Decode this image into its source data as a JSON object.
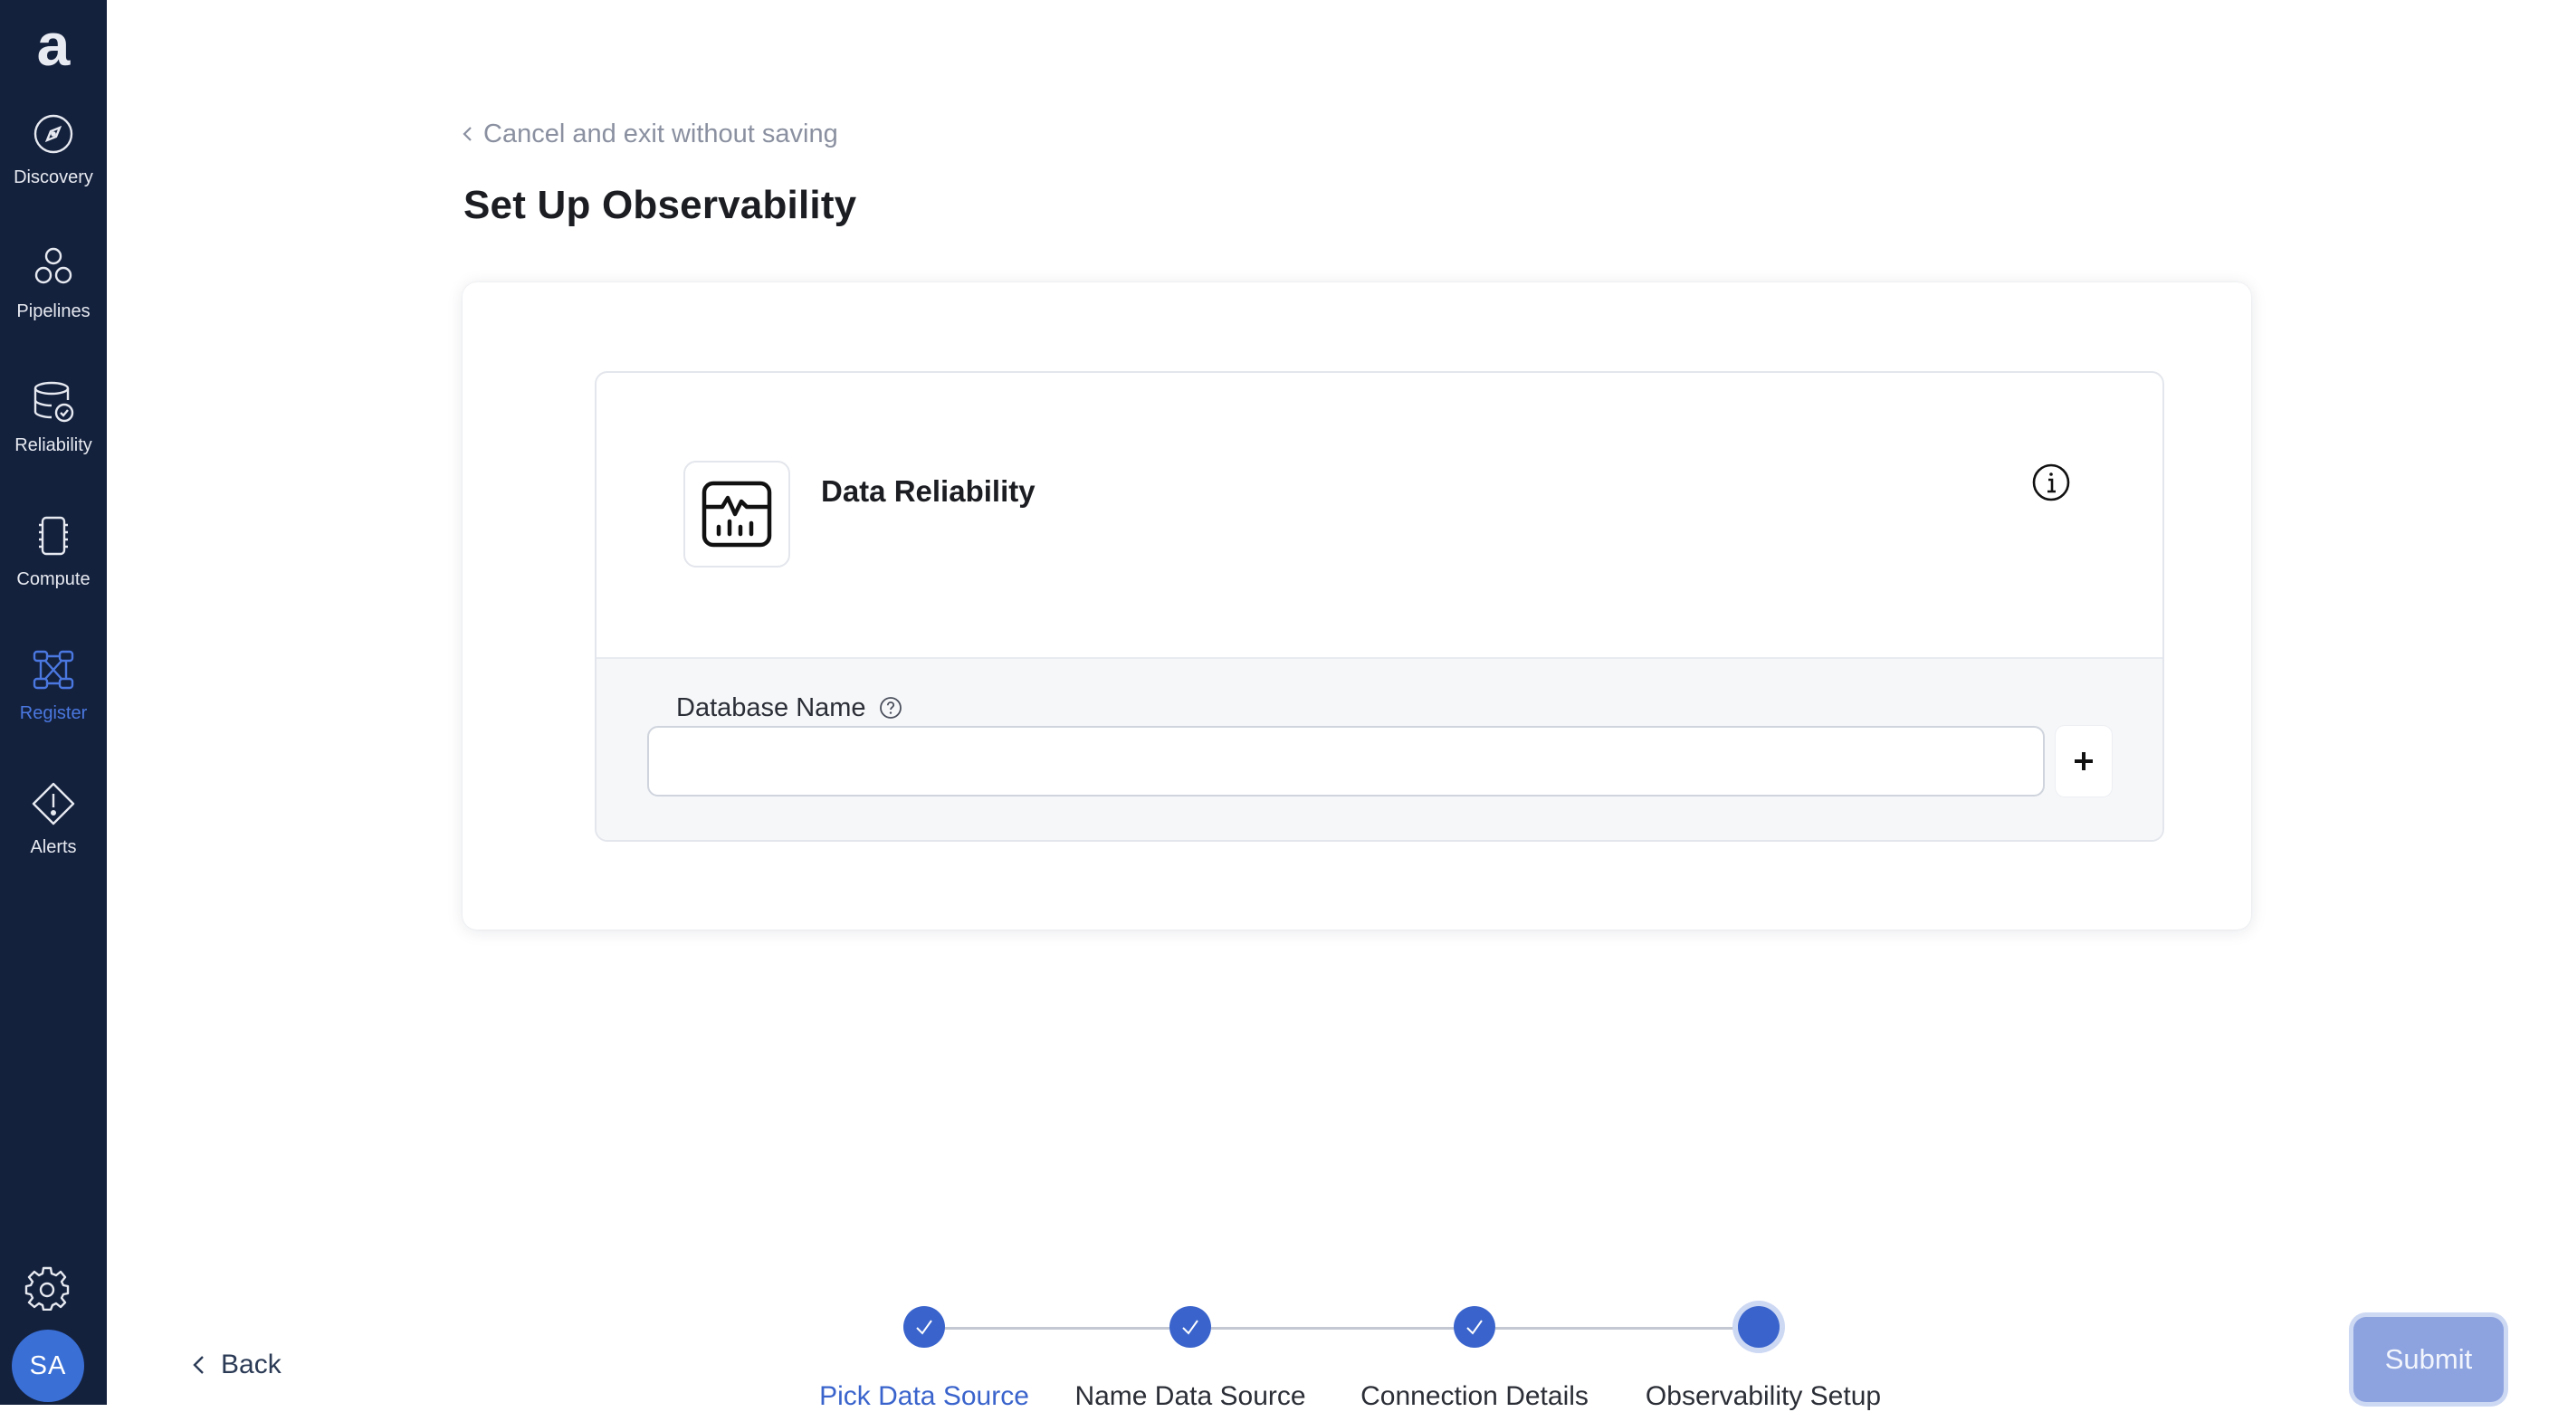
{
  "sidebar": {
    "logo": "a",
    "items": [
      {
        "label": "Discovery",
        "icon": "compass-icon"
      },
      {
        "label": "Pipelines",
        "icon": "pipelines-icon"
      },
      {
        "label": "Reliability",
        "icon": "database-check-icon"
      },
      {
        "label": "Compute",
        "icon": "chip-icon"
      },
      {
        "label": "Register",
        "icon": "register-network-icon",
        "active": true
      },
      {
        "label": "Alerts",
        "icon": "alert-diamond-icon"
      }
    ],
    "settings_icon": "gear-icon",
    "avatar_initials": "SA"
  },
  "header": {
    "cancel_link": "Cancel and exit without saving",
    "title": "Set Up Observability"
  },
  "product": {
    "title": "Data Reliability",
    "icon": "monitor-chart-icon"
  },
  "form": {
    "database_label": "Database Name",
    "database_value": "",
    "database_placeholder": ""
  },
  "footer": {
    "back_label": "Back",
    "submit_label": "Submit",
    "steps": [
      {
        "label": "Pick Data Source",
        "status": "complete"
      },
      {
        "label": "Name Data Source",
        "status": "complete"
      },
      {
        "label": "Connection Details",
        "status": "complete"
      },
      {
        "label": "Observability Setup",
        "status": "current"
      }
    ]
  },
  "colors": {
    "sidebar_bg": "#14213d",
    "accent": "#3a64cc",
    "submit_disabled": "#8da3e0",
    "muted_text": "#8a90a0"
  }
}
